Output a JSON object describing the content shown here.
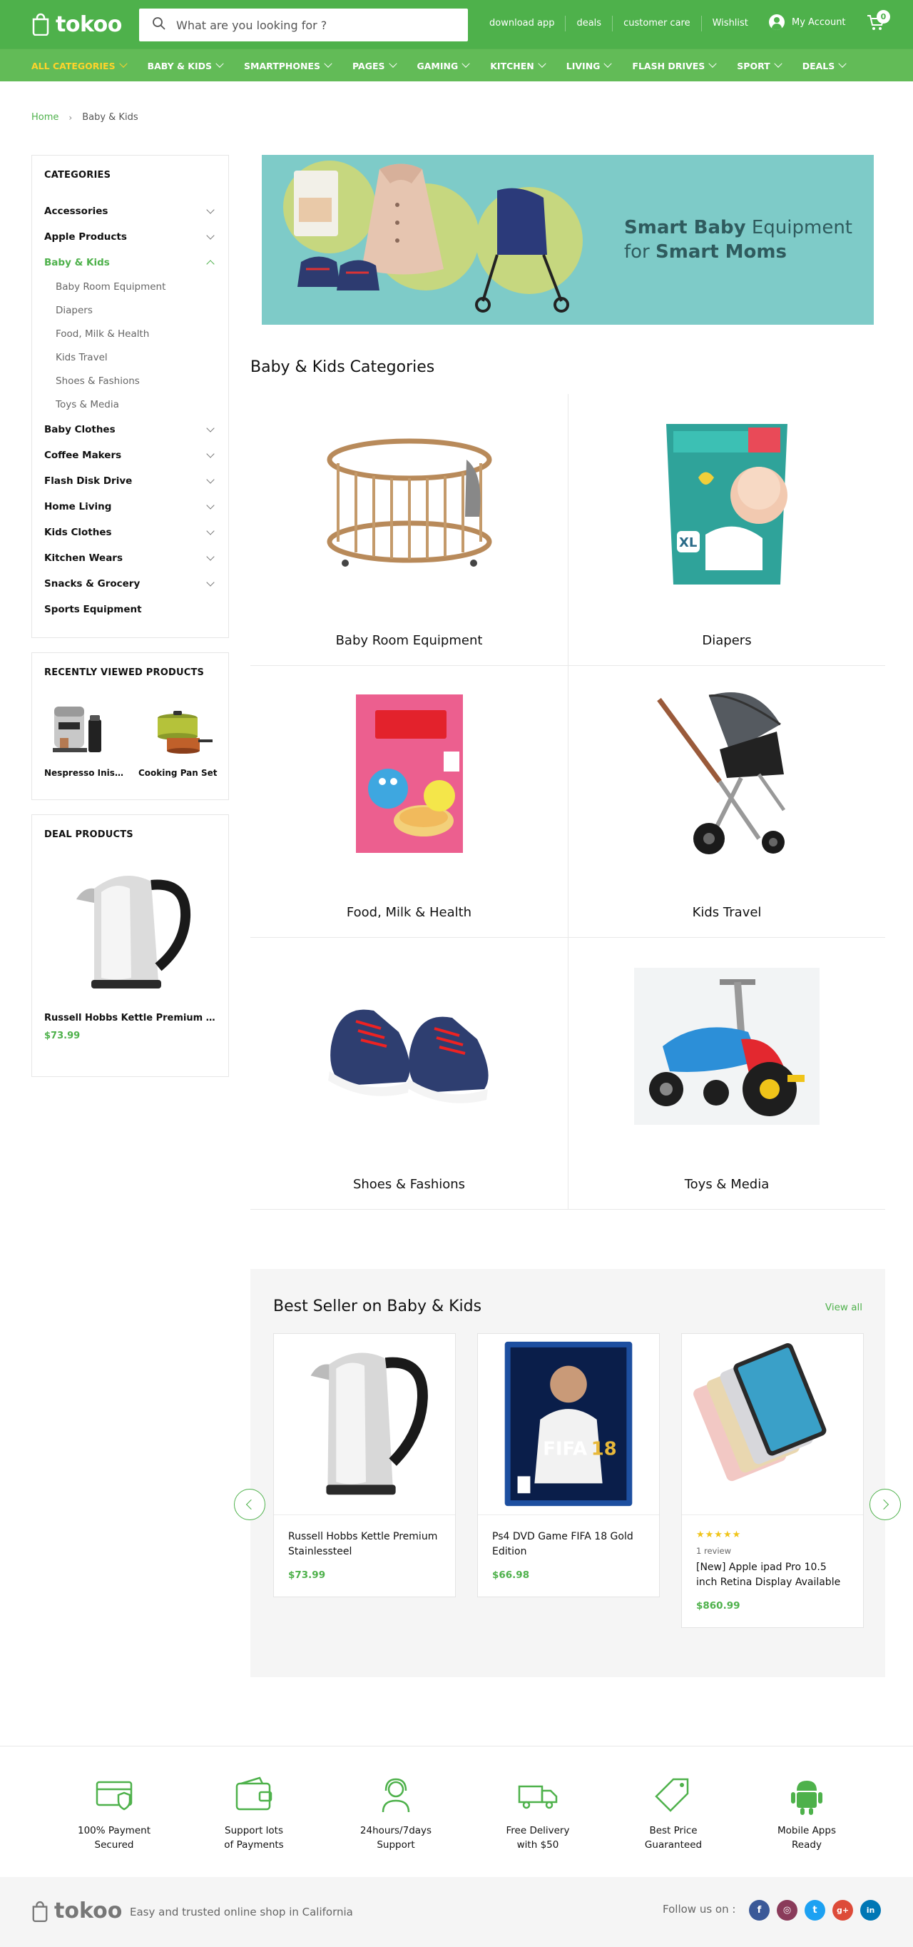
{
  "header": {
    "logo_text": "tokoo",
    "search_placeholder": "What are you looking for ?",
    "links": [
      "download app",
      "deals",
      "customer care",
      "Wishlist"
    ],
    "account_label": "My Account",
    "cart_count": "0"
  },
  "nav": {
    "items": [
      "ALL CATEGORIES",
      "BABY & KIDS",
      "SMARTPHONES",
      "PAGES",
      "GAMING",
      "KITCHEN",
      "LIVING",
      "FLASH DRIVES",
      "SPORT",
      "DEALS"
    ]
  },
  "breadcrumb": {
    "home": "Home",
    "current": "Baby & Kids"
  },
  "sidebar": {
    "categories_title": "CATEGORIES",
    "categories": [
      {
        "label": "Accessories"
      },
      {
        "label": "Apple Products"
      },
      {
        "label": "Baby & Kids"
      },
      {
        "label": "Baby Clothes"
      },
      {
        "label": "Coffee Makers"
      },
      {
        "label": "Flash Disk Drive"
      },
      {
        "label": "Home Living"
      },
      {
        "label": "Kids Clothes"
      },
      {
        "label": "Kitchen Wears"
      },
      {
        "label": "Snacks & Grocery"
      },
      {
        "label": "Sports Equipment"
      }
    ],
    "subcategories": [
      "Baby Room Equipment",
      "Diapers",
      "Food, Milk & Health",
      "Kids Travel",
      "Shoes & Fashions",
      "Toys & Media"
    ],
    "recent_title": "RECENTLY VIEWED PRODUCTS",
    "recent": [
      {
        "name": "Nespresso Inissia Espresso Maker"
      },
      {
        "name": "Cooking Pan Set"
      }
    ],
    "deal_title": "DEAL PRODUCTS",
    "deal": {
      "name": "Russell Hobbs Kettle Premium Stainlessteel",
      "price": "$73.99"
    }
  },
  "banner": {
    "line1_bold": "Smart Baby",
    "line1_rest": "Equipment",
    "line2_pre": "for",
    "line2_bold": "Smart Moms"
  },
  "categories_section": {
    "title": "Baby & Kids Categories",
    "items": [
      "Baby Room Equipment",
      "Diapers",
      "Food, Milk & Health",
      "Kids Travel",
      "Shoes & Fashions",
      "Toys & Media"
    ]
  },
  "best_seller": {
    "title": "Best Seller on Baby & Kids",
    "view_all": "View all",
    "products": [
      {
        "name": "Russell Hobbs Kettle Premium Stainlessteel",
        "price": "$73.99"
      },
      {
        "name": "Ps4 DVD Game FIFA 18 Gold Edition",
        "price": "$66.98"
      },
      {
        "name": "[New] Apple ipad Pro 10.5 inch Retina Display Available",
        "price": "$860.99",
        "rating": 5,
        "reviews": "1 review",
        "stars": "★★★★★"
      }
    ]
  },
  "features": [
    {
      "line1": "100% Payment",
      "line2": "Secured"
    },
    {
      "line1": "Support lots",
      "line2": "of Payments"
    },
    {
      "line1": "24hours/7days",
      "line2": "Support"
    },
    {
      "line1": "Free Delivery",
      "line2": "with $50"
    },
    {
      "line1": "Best Price",
      "line2": "Guaranteed"
    },
    {
      "line1": "Mobile Apps",
      "line2": "Ready"
    }
  ],
  "footer": {
    "logo_text": "tokoo",
    "tagline": "Easy and trusted online shop in California",
    "follow_label": "Follow us on :",
    "social": [
      {
        "icon": "facebook-icon",
        "glyph": "f",
        "color": "#3b5998"
      },
      {
        "icon": "instagram-icon",
        "glyph": "◎",
        "color": "#8a3b5a"
      },
      {
        "icon": "twitter-icon",
        "glyph": "t",
        "color": "#1da1f2"
      },
      {
        "icon": "google-plus-icon",
        "glyph": "g+",
        "color": "#dd4b39"
      },
      {
        "icon": "linkedin-icon",
        "glyph": "in",
        "color": "#0077b5"
      }
    ]
  },
  "colors": {
    "brand_green": "#4eb14b",
    "nav_green": "#62bb57",
    "active_nav": "#ffd42a",
    "banner_bg": "#7ecbc8"
  }
}
